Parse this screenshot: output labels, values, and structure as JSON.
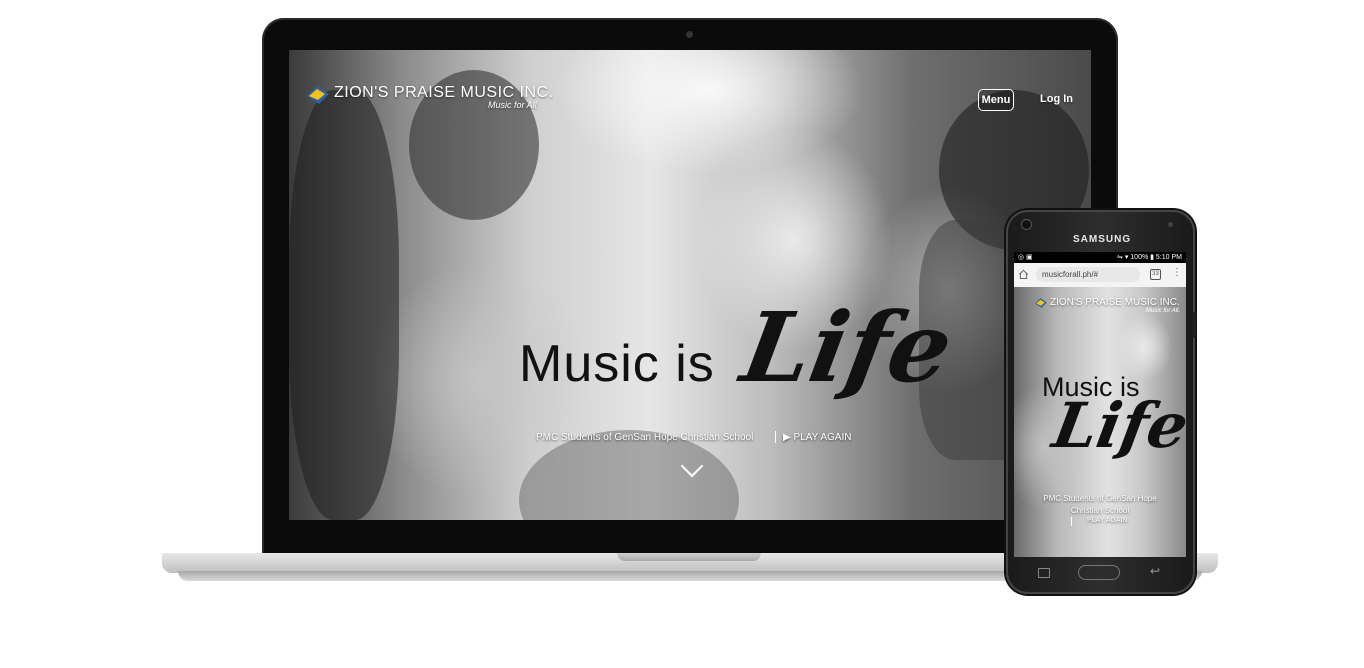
{
  "desktop": {
    "brand": {
      "name": "ZION'S PRAISE MUSIC INC.",
      "tagline": "Music for All."
    },
    "nav": {
      "menu_label": "Menu",
      "login_label": "Log In"
    },
    "hero": {
      "title": "Music is",
      "script_word": "Life",
      "caption": "PMC Students of GenSan Hope Christian School",
      "play_label": "▶ PLAY AGAIN"
    }
  },
  "phone": {
    "brand_label": "SAMSUNG",
    "status": {
      "left": "◎ ▣",
      "right": "⇋ ▾ 100% ▮ 5:10 PM"
    },
    "browser": {
      "url": "musicforall.ph/#",
      "tabs_count": "33"
    },
    "site": {
      "brand": {
        "name": "ZION'S PRAISE MUSIC INC.",
        "tagline": "Music for All."
      },
      "hero": {
        "title": "Music is",
        "script_word": "Life",
        "caption": "PMC Students of GenSan Hope Christian School",
        "play_label": "PLAY AGAIN"
      }
    }
  },
  "colors": {
    "logo_yellow": "#f2c21b",
    "logo_blue": "#2f5fa8",
    "screen_text_dark": "#111111",
    "overlay_text": "#ffffff"
  },
  "icons": [
    "logo-badge-icon",
    "play-icon",
    "chevron-down-icon",
    "home-icon",
    "tabs-icon",
    "more-vert-icon",
    "recents-icon",
    "nav-home-button",
    "back-icon"
  ]
}
